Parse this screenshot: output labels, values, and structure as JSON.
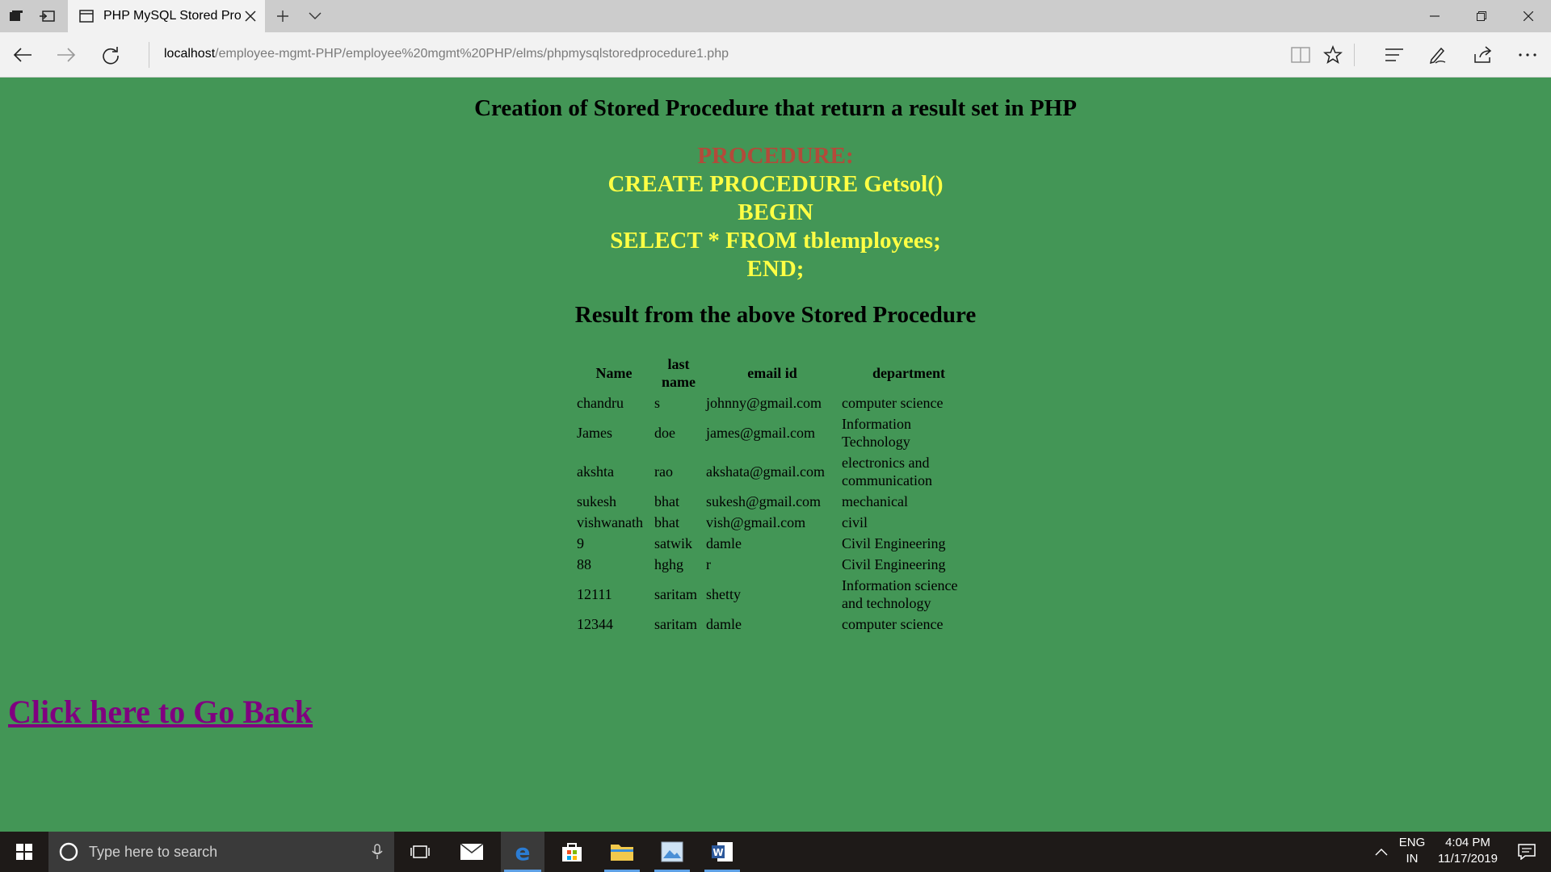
{
  "browser": {
    "tab_title": "PHP MySQL Stored Proc",
    "address_host": "localhost",
    "address_path": "/employee-mgmt-PHP/employee%20mgmt%20PHP/elms/phpmysqlstoredprocedure1.php"
  },
  "page": {
    "heading": "Creation of Stored Procedure that return a result set in PHP",
    "procedure_label": "PROCEDURE:",
    "procedure_lines": [
      "CREATE PROCEDURE Getsol()",
      "BEGIN",
      "SELECT * FROM tblemployees;",
      "END;"
    ],
    "result_heading": "Result from the above Stored Procedure",
    "table": {
      "headers": [
        "Name",
        "last name",
        "email id",
        "department"
      ],
      "rows": [
        [
          "chandru",
          "s",
          "johnny@gmail.com",
          "computer science"
        ],
        [
          "James",
          "doe",
          "james@gmail.com",
          "Information Technology"
        ],
        [
          "akshta",
          "rao",
          "akshata@gmail.com",
          "electronics and communication"
        ],
        [
          "sukesh",
          "bhat",
          "sukesh@gmail.com",
          "mechanical"
        ],
        [
          "vishwanath",
          "bhat",
          "vish@gmail.com",
          "civil"
        ],
        [
          "9",
          "satwik",
          "damle",
          "Civil Engineering"
        ],
        [
          "88",
          "hghg",
          "r",
          "Civil Engineering"
        ],
        [
          "12111",
          "saritam",
          "shetty",
          "Information science and technology"
        ],
        [
          "12344",
          "saritam",
          "damle",
          "computer science"
        ]
      ]
    },
    "go_back_link": "Click here to Go Back"
  },
  "taskbar": {
    "search_placeholder": "Type here to search",
    "language": "ENG",
    "region": "IN",
    "time": "4:04 PM",
    "date": "11/17/2019"
  },
  "colors": {
    "page_background": "#439656",
    "procedure_text": "#ffff44",
    "procedure_label": "#b34a3a",
    "link": "#800080"
  }
}
